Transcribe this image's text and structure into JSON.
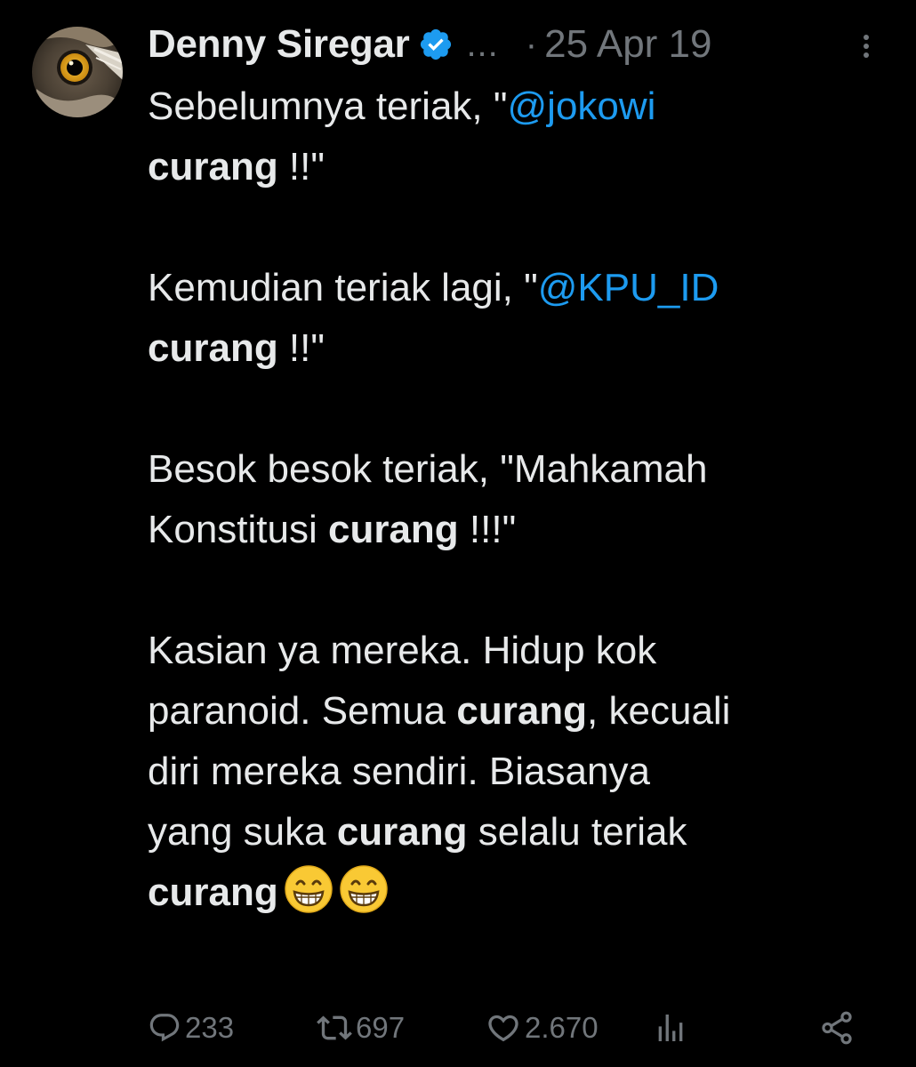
{
  "tweet": {
    "author": {
      "display_name": "Denny Siregar",
      "verified": true,
      "avatar_icon": "owl-eye-avatar"
    },
    "header_ellipsis": "...",
    "separator": "·",
    "timestamp": "25 Apr 19",
    "paragraphs": [
      {
        "line1_prefix": "Sebelumnya teriak, \"",
        "line1_mention": "@jokowi",
        "line2_bold": "curang",
        "line2_suffix": " !!\""
      },
      {
        "line1_prefix": "Kemudian teriak lagi, \"",
        "line1_mention": "@KPU_ID",
        "line2_bold": "curang",
        "line2_suffix": " !!\""
      },
      {
        "line1": "Besok besok teriak, \"Mahkamah",
        "line2_prefix": "Konstitusi ",
        "line2_bold": "curang",
        "line2_suffix": " !!!\""
      },
      {
        "line1": "Kasian ya mereka. Hidup kok",
        "line2_prefix": "paranoid. Semua ",
        "line2_bold": "curang",
        "line2_suffix": ", kecuali",
        "line3": "diri mereka sendiri. Biasanya",
        "line4_prefix": "yang suka ",
        "line4_bold": "curang",
        "line4_suffix": " selalu teriak",
        "line5_bold": "curang"
      }
    ],
    "emoji": [
      "grinning-face-with-smiling-eyes",
      "grinning-face-with-smiling-eyes"
    ],
    "stats": {
      "replies": "233",
      "retweets": "697",
      "likes": "2.670"
    }
  },
  "colors": {
    "background": "#000000",
    "text": "#e7e9ea",
    "secondary": "#71767b",
    "link": "#1d9bf0",
    "verified": "#1d9bf0"
  }
}
